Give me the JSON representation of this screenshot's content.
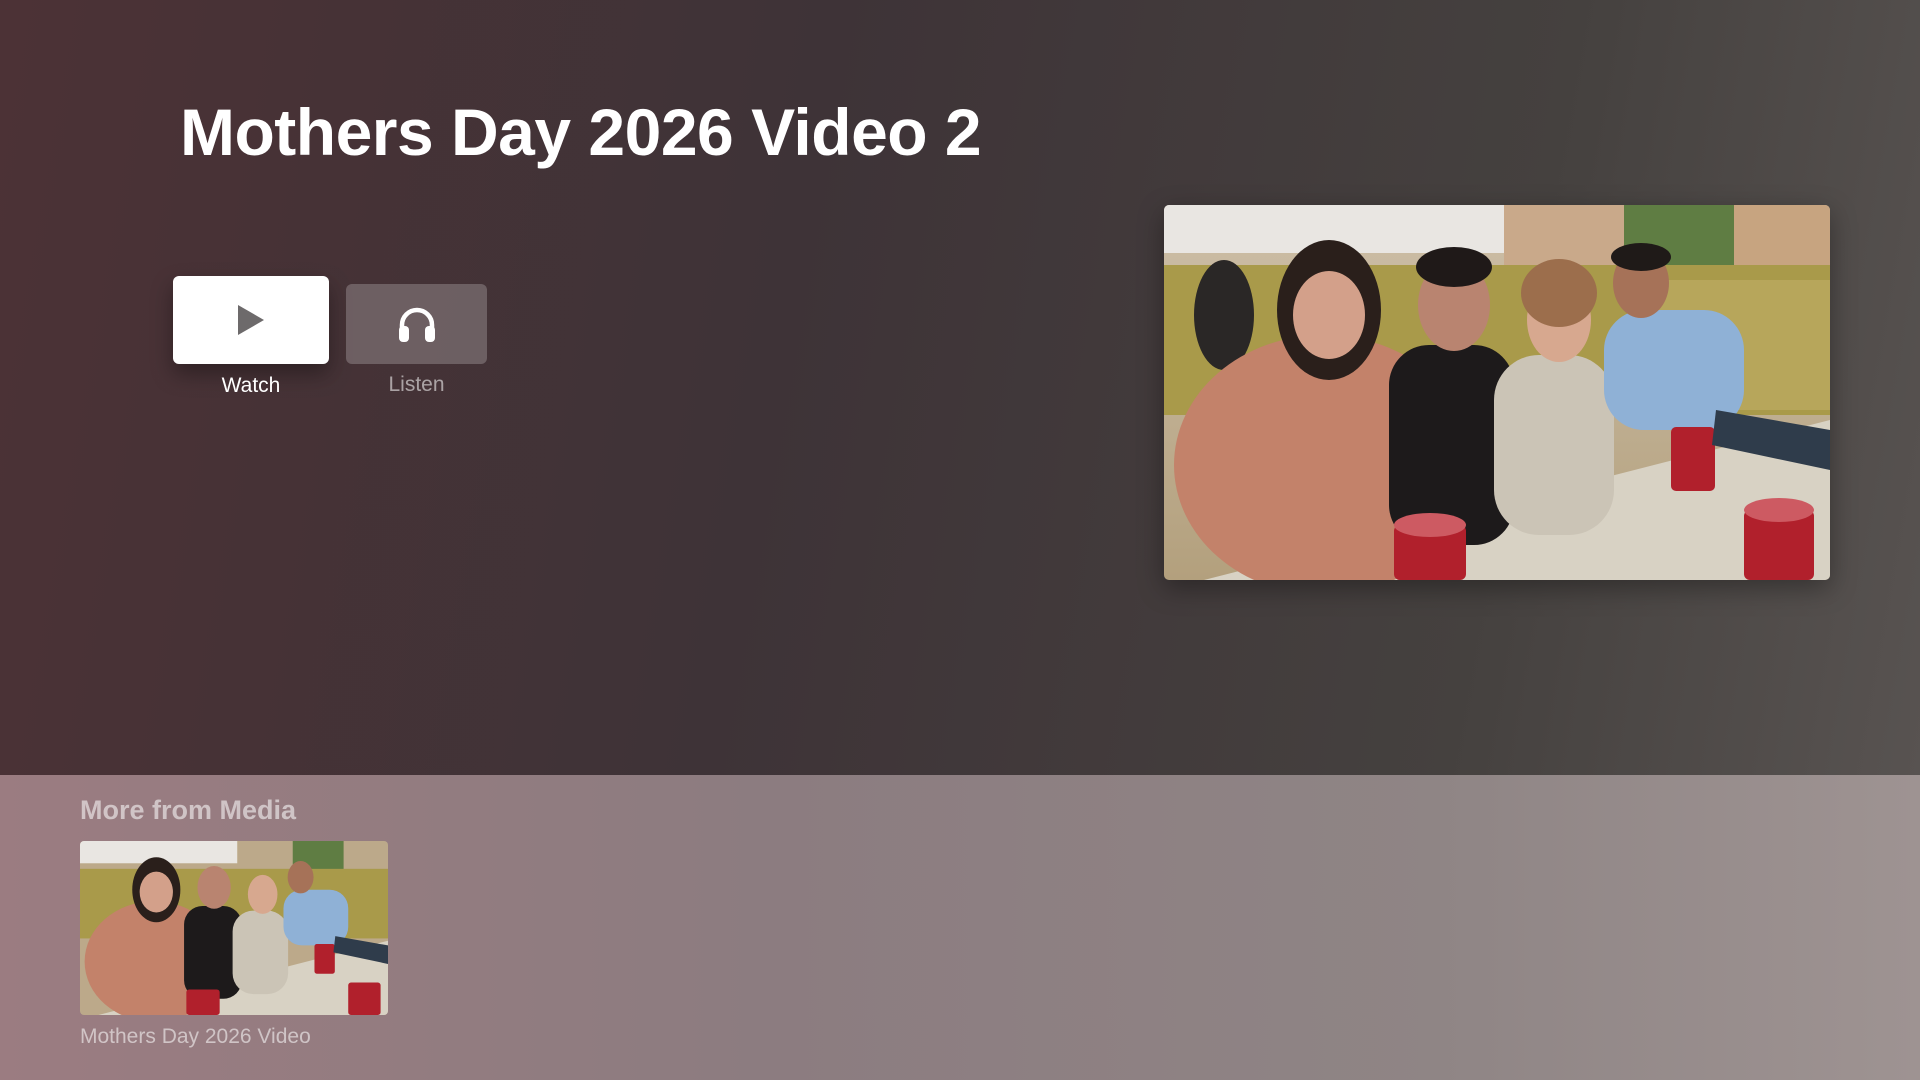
{
  "page": {
    "title": "Mothers Day 2026 Video 2"
  },
  "actions": {
    "watch_label": "Watch",
    "listen_label": "Listen",
    "watch_icon": "play-icon",
    "listen_icon": "headphones-icon"
  },
  "shelf": {
    "title": "More from Media",
    "items": [
      {
        "caption": "Mothers Day 2026 Video"
      }
    ]
  }
}
